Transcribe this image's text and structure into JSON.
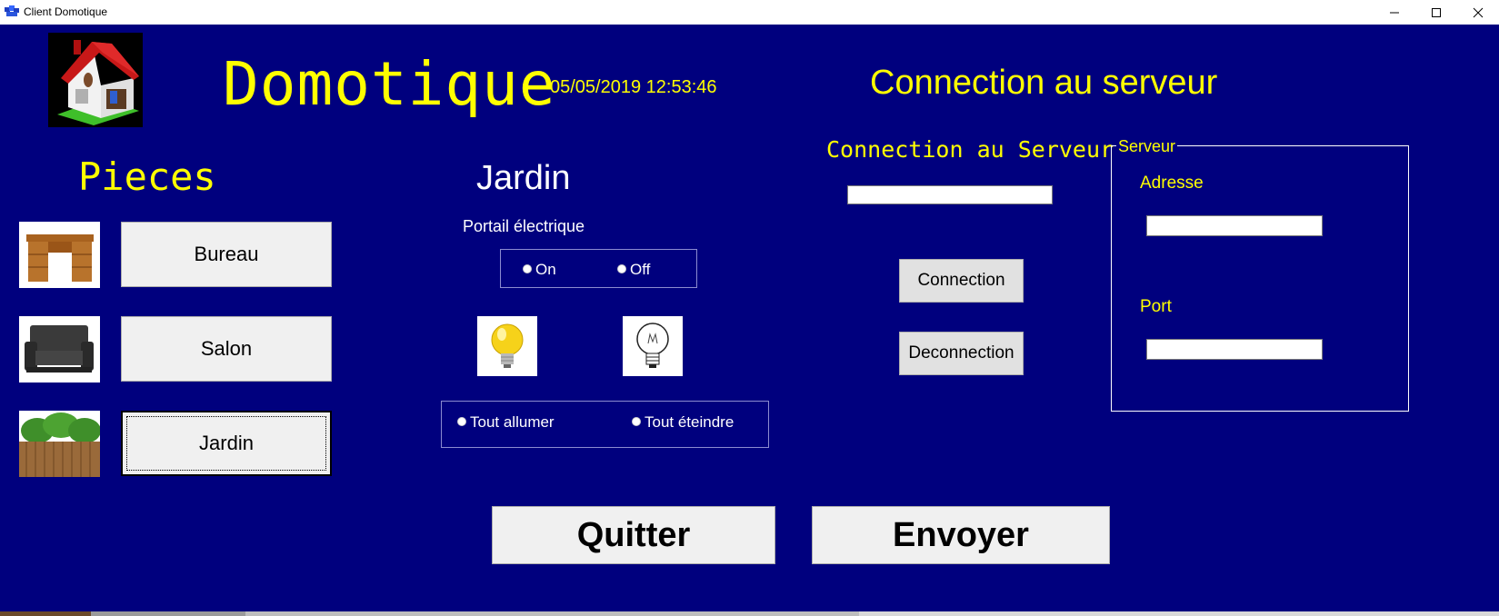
{
  "window": {
    "title": "Client Domotique",
    "controls": [
      "minimize-icon",
      "maximize-icon",
      "close-icon"
    ]
  },
  "colors": {
    "background": "#00007e",
    "accent_text": "#ffff00",
    "text": "#ffffff",
    "button_face": "#f0f0f0"
  },
  "header": {
    "title": "Domotique",
    "datetime": "05/05/2019 12:53:46",
    "connection_title": "Connection au serveur"
  },
  "rooms": {
    "heading": "Pieces",
    "items": [
      {
        "label": "Bureau",
        "icon": "desk-icon"
      },
      {
        "label": "Salon",
        "icon": "sofa-icon"
      },
      {
        "label": "Jardin",
        "icon": "garden-icon",
        "focused": true
      }
    ]
  },
  "room_panel": {
    "title": "Jardin",
    "gate_label": "Portail électrique",
    "gate_on": "On",
    "gate_off": "Off",
    "lamp_on_icon": "bulb-on-icon",
    "lamp_off_icon": "bulb-off-icon",
    "all_on": "Tout allumer",
    "all_off": "Tout éteindre"
  },
  "connection": {
    "heading": "Connection au Serveur",
    "status_value": "",
    "connect_label": "Connection",
    "disconnect_label": "Deconnection"
  },
  "server": {
    "legend": "Serveur",
    "address_label": "Adresse",
    "address_value": "",
    "port_label": "Port",
    "port_value": ""
  },
  "actions": {
    "quit_label": "Quitter",
    "send_label": "Envoyer"
  }
}
